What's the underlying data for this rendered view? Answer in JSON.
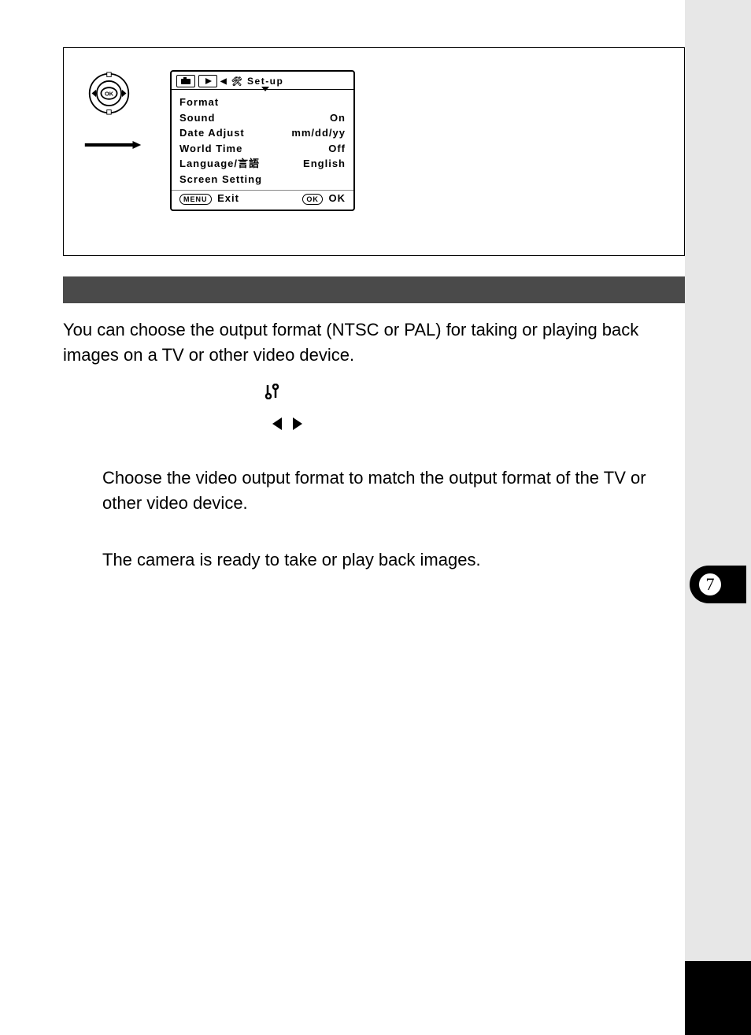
{
  "lcd": {
    "title": "Set-up",
    "rows": [
      {
        "label": "Format",
        "value": ""
      },
      {
        "label": "Sound",
        "value": "On"
      },
      {
        "label": "Date Adjust",
        "value": "mm/dd/yy"
      },
      {
        "label": "World Time",
        "value": "Off"
      },
      {
        "label": "Language/言語",
        "value": "English"
      },
      {
        "label": "Screen Setting",
        "value": ""
      }
    ],
    "footer_left_pill": "MENU",
    "footer_left": "Exit",
    "footer_right_pill": "OK",
    "footer_right": "OK"
  },
  "intro_text": "You can choose the output format (NTSC or PAL) for taking or playing back images on a TV or other video device.",
  "sub_text_1": "Choose the video output format to match the output format of the TV or other video device.",
  "sub_text_2": "The camera is ready to take or play back images.",
  "side_tab_number": "7"
}
